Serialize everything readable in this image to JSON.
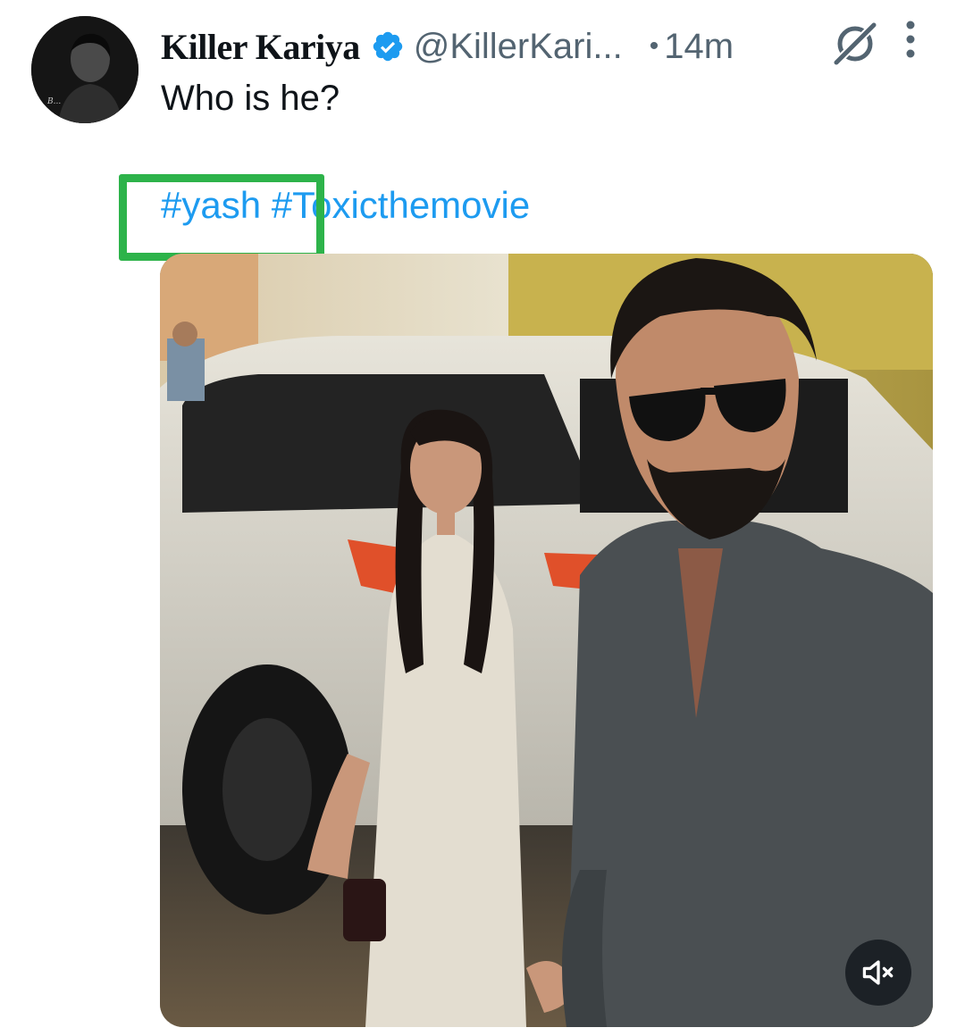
{
  "tweet": {
    "author": {
      "display_name": "Killer Kariya",
      "handle": "@KillerKari...",
      "verified": true,
      "avatar_icon": "profile-avatar"
    },
    "separator": "•",
    "timestamp": "14m",
    "text": "Who is he?",
    "hashtags": [
      "#yash",
      "#Toxicthemovie"
    ],
    "header_icons": [
      "grok-icon",
      "more-vertical-icon"
    ],
    "media": {
      "type": "video",
      "control_icon": "volume-muted-icon"
    }
  },
  "colors": {
    "link": "#1d9bf0",
    "secondary_text": "#536471",
    "primary_text": "#0f1419",
    "highlight_box": "#2db34a",
    "verified_badge": "#1d9bf0"
  }
}
